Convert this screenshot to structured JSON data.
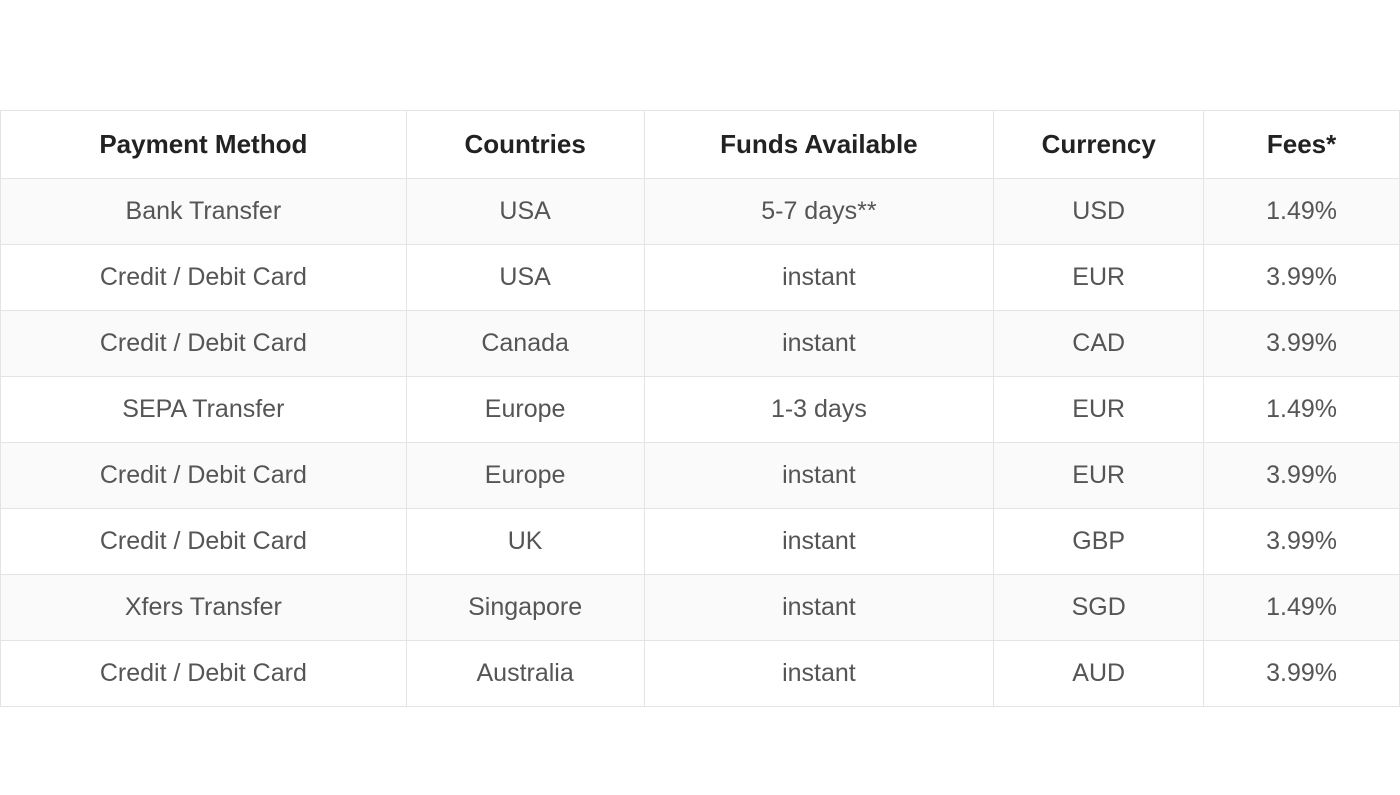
{
  "table": {
    "headers": {
      "payment_method": "Payment Method",
      "countries": "Countries",
      "funds_available": "Funds Available",
      "currency": "Currency",
      "fees": "Fees*"
    },
    "rows": [
      {
        "payment_method": "Bank Transfer",
        "countries": "USA",
        "funds_available": "5-7 days**",
        "currency": "USD",
        "fees": "1.49%"
      },
      {
        "payment_method": "Credit / Debit Card",
        "countries": "USA",
        "funds_available": "instant",
        "currency": "EUR",
        "fees": "3.99%"
      },
      {
        "payment_method": "Credit / Debit Card",
        "countries": "Canada",
        "funds_available": "instant",
        "currency": "CAD",
        "fees": "3.99%"
      },
      {
        "payment_method": "SEPA Transfer",
        "countries": "Europe",
        "funds_available": "1-3 days",
        "currency": "EUR",
        "fees": "1.49%"
      },
      {
        "payment_method": "Credit / Debit Card",
        "countries": "Europe",
        "funds_available": "instant",
        "currency": "EUR",
        "fees": "3.99%"
      },
      {
        "payment_method": "Credit / Debit Card",
        "countries": "UK",
        "funds_available": "instant",
        "currency": "GBP",
        "fees": "3.99%"
      },
      {
        "payment_method": "Xfers Transfer",
        "countries": "Singapore",
        "funds_available": "instant",
        "currency": "SGD",
        "fees": "1.49%"
      },
      {
        "payment_method": "Credit / Debit Card",
        "countries": "Australia",
        "funds_available": "instant",
        "currency": "AUD",
        "fees": "3.99%"
      }
    ]
  }
}
